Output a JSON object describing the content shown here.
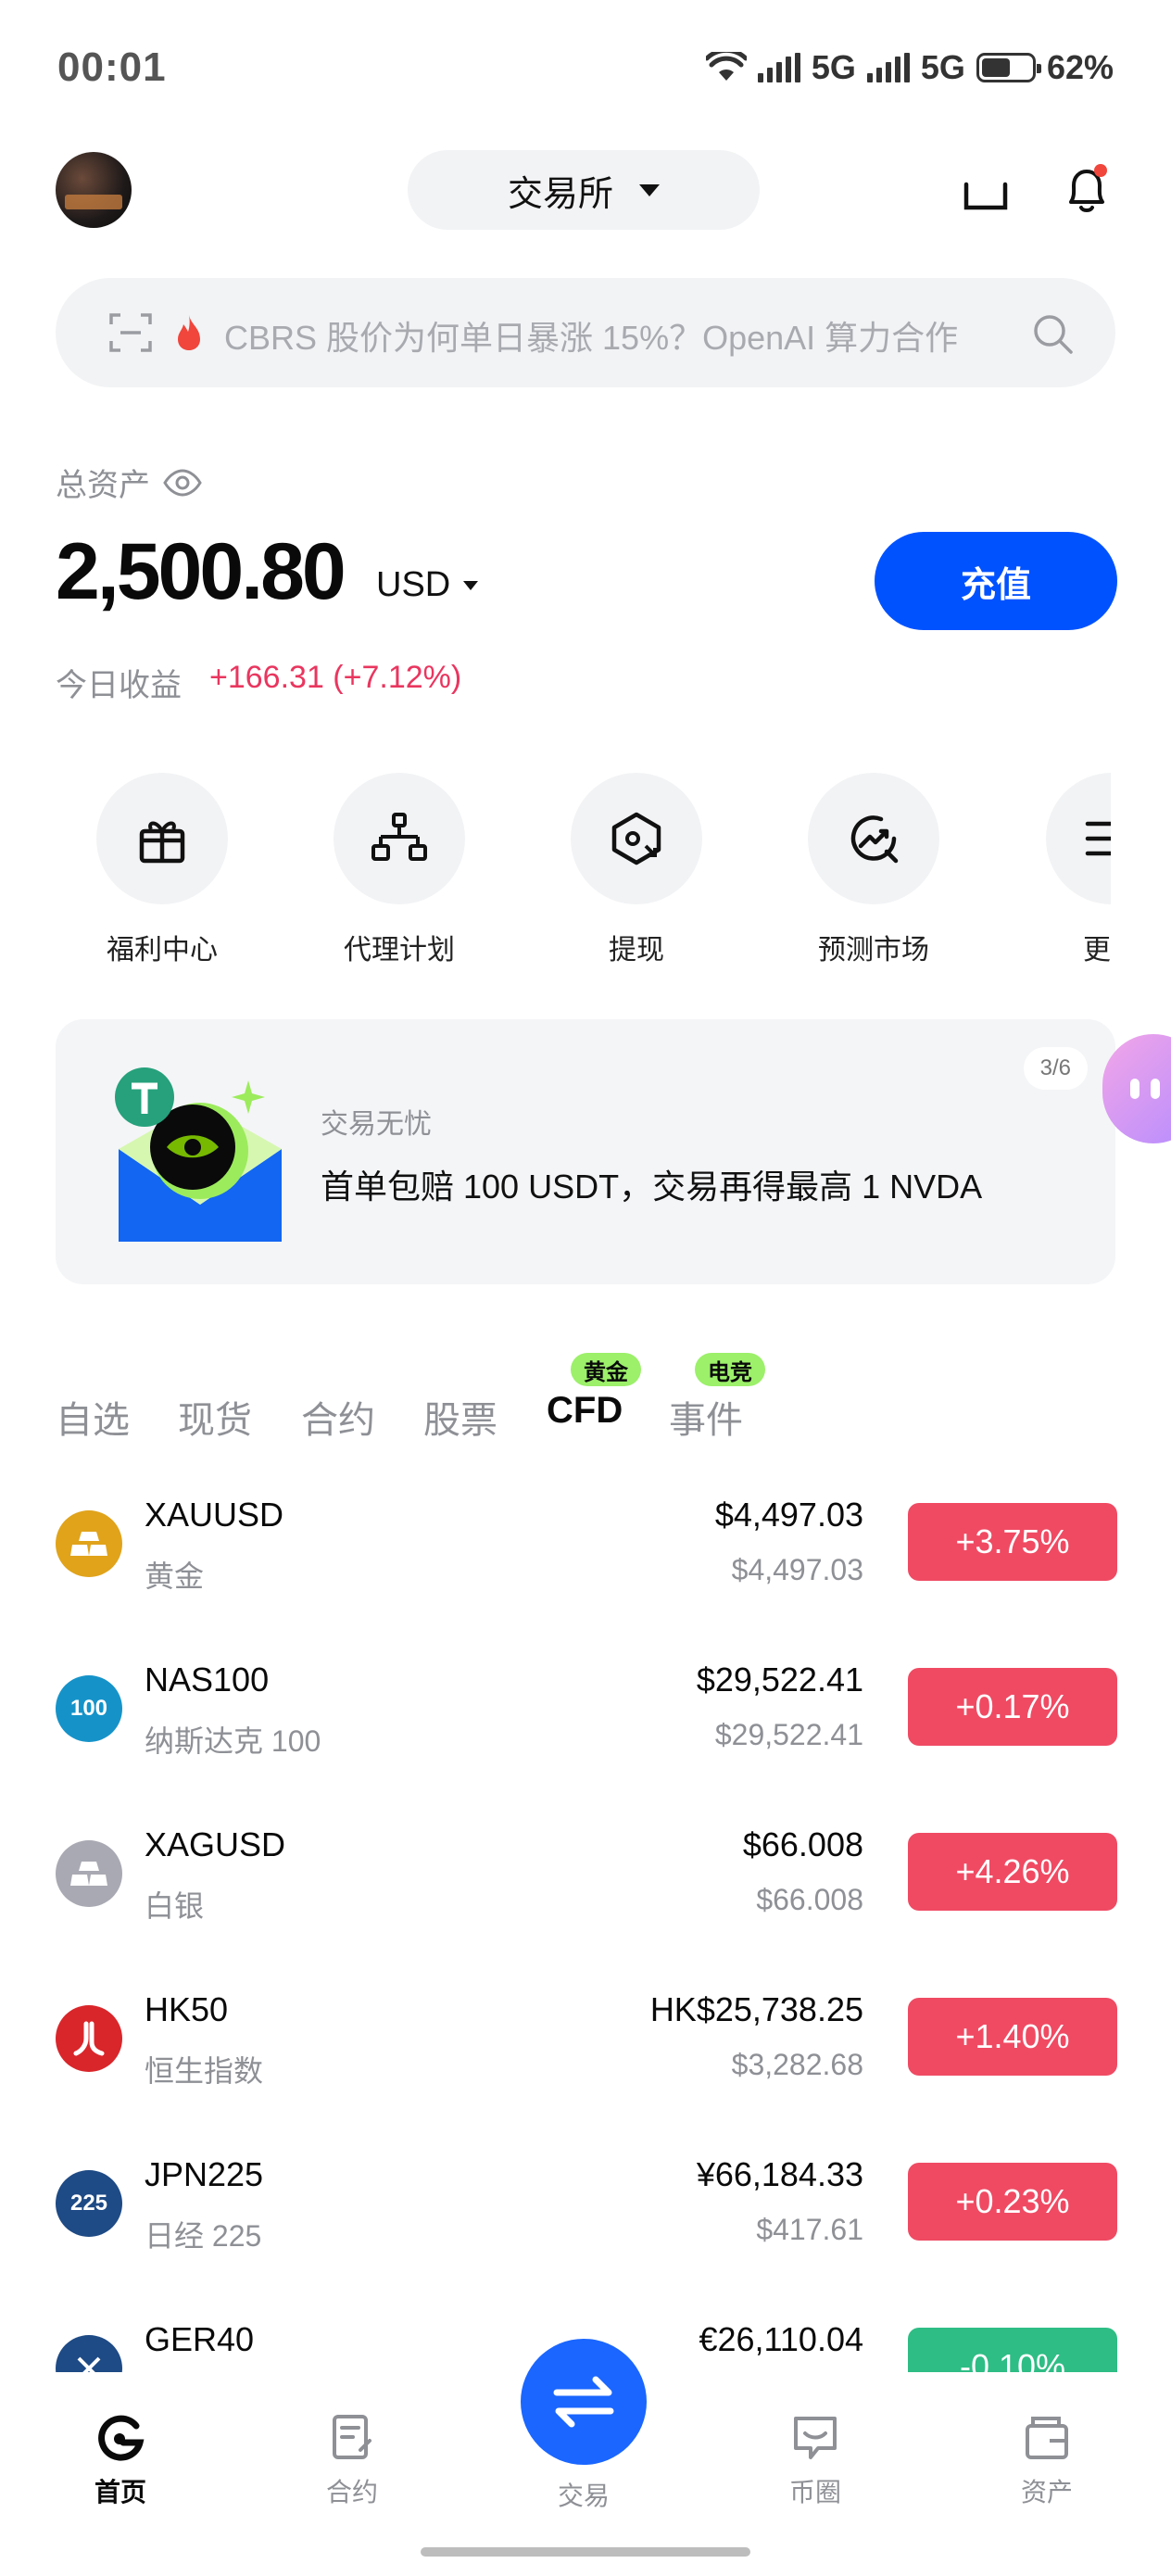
{
  "status_bar": {
    "time": "00:01",
    "network_1": "5G",
    "network_2": "5G",
    "battery": "62%"
  },
  "header": {
    "exchange_label": "交易所"
  },
  "search": {
    "text": "CBRS 股价为何单日暴涨 15%？OpenAI 算力合作"
  },
  "assets": {
    "label": "总资产",
    "value": "2,500.80",
    "unit": "USD",
    "deposit_label": "充值",
    "pnl_label": "今日收益",
    "pnl_value": "+166.31 (+7.12%)"
  },
  "shortcuts": [
    {
      "label": "福利中心",
      "icon": "gift-icon"
    },
    {
      "label": "代理计划",
      "icon": "org-chart-icon"
    },
    {
      "label": "提现",
      "icon": "withdraw-icon"
    },
    {
      "label": "预测市场",
      "icon": "prediction-icon"
    },
    {
      "label": "更",
      "icon": "more-icon"
    }
  ],
  "banner": {
    "subtitle": "交易无忧",
    "title": "首单包赔 100 USDT，交易再得最高 1 NVDA",
    "page": "3/6"
  },
  "tabs": [
    {
      "label": "自选"
    },
    {
      "label": "现货"
    },
    {
      "label": "合约"
    },
    {
      "label": "股票"
    },
    {
      "label": "CFD",
      "badge": "黄金",
      "active": true
    },
    {
      "label": "事件",
      "badge": "电竞"
    }
  ],
  "markets": [
    {
      "symbol": "XAUUSD",
      "name": "黄金",
      "price": "$4,497.03",
      "usd": "$4,497.03",
      "change": "+3.75%",
      "direction": "up",
      "icon_color": "#e0a31a",
      "icon_text": ""
    },
    {
      "symbol": "NAS100",
      "name": "纳斯达克 100",
      "price": "$29,522.41",
      "usd": "$29,522.41",
      "change": "+0.17%",
      "direction": "up",
      "icon_color": "#1593c9",
      "icon_text": "100"
    },
    {
      "symbol": "XAGUSD",
      "name": "白银",
      "price": "$66.008",
      "usd": "$66.008",
      "change": "+4.26%",
      "direction": "up",
      "icon_color": "#a9a9b3",
      "icon_text": ""
    },
    {
      "symbol": "HK50",
      "name": "恒生指数",
      "price": "HK$25,738.25",
      "usd": "$3,282.68",
      "change": "+1.40%",
      "direction": "up",
      "icon_color": "#d9262b",
      "icon_text": ""
    },
    {
      "symbol": "JPN225",
      "name": "日经 225",
      "price": "¥66,184.33",
      "usd": "$417.61",
      "change": "+0.23%",
      "direction": "up",
      "icon_color": "#1e4a85",
      "icon_text": "225"
    },
    {
      "symbol": "GER40",
      "name": "",
      "price": "€26,110.04",
      "usd": "",
      "change": "-0.10%",
      "direction": "down",
      "icon_color": "#1e4a85",
      "icon_text": ""
    }
  ],
  "bottom_nav": {
    "home": "首页",
    "futures": "合约",
    "trade": "交易",
    "community": "币圈",
    "assets": "资产"
  }
}
